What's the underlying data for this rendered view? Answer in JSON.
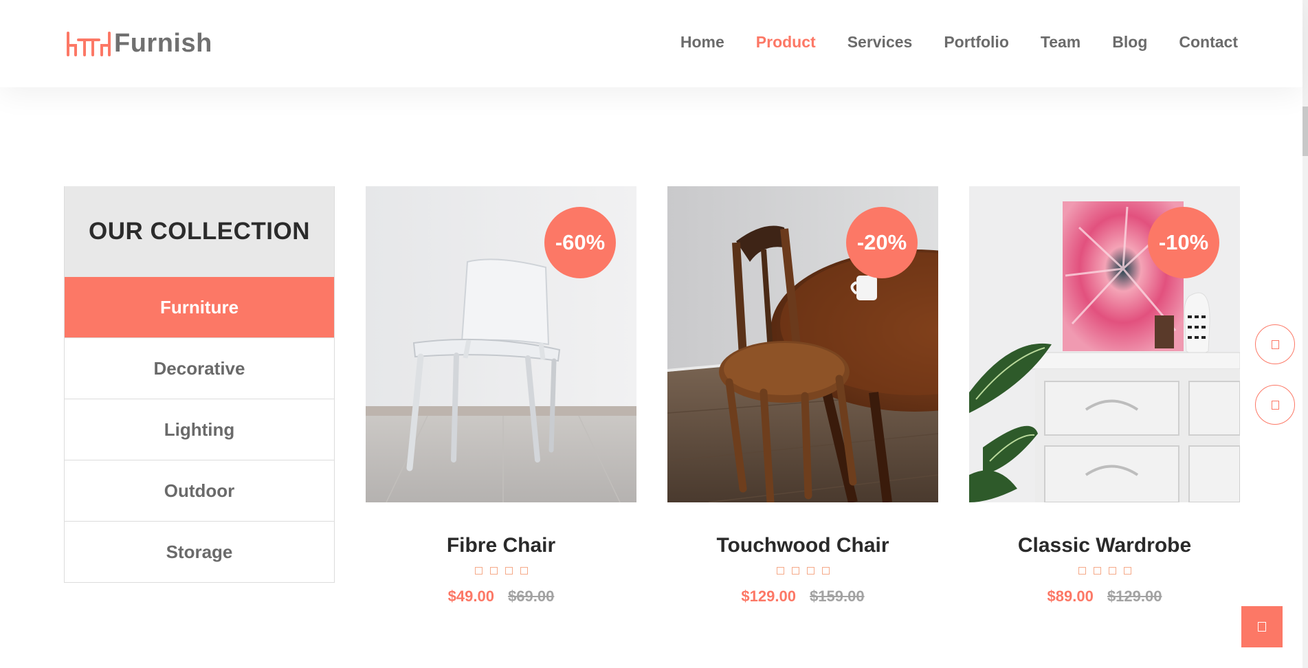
{
  "brand": {
    "name": "Furnish",
    "accent": "#fc7866"
  },
  "nav": {
    "items": [
      {
        "label": "Home"
      },
      {
        "label": "Product"
      },
      {
        "label": "Services"
      },
      {
        "label": "Portfolio"
      },
      {
        "label": "Team"
      },
      {
        "label": "Blog"
      },
      {
        "label": "Contact"
      }
    ],
    "active": "Product"
  },
  "collection": {
    "title": "OUR COLLECTION",
    "categories": [
      {
        "label": "Furniture"
      },
      {
        "label": "Decorative"
      },
      {
        "label": "Lighting"
      },
      {
        "label": "Outdoor"
      },
      {
        "label": "Storage"
      }
    ],
    "active": "Furniture"
  },
  "products": [
    {
      "name": "Fibre Chair",
      "discount": "-60%",
      "price": "$49.00",
      "old_price": "$69.00",
      "image": "white-plastic-chair"
    },
    {
      "name": "Touchwood Chair",
      "discount": "-20%",
      "price": "$129.00",
      "old_price": "$159.00",
      "image": "wooden-chair-table"
    },
    {
      "name": "Classic Wardrobe",
      "discount": "-10%",
      "price": "$89.00",
      "old_price": "$129.00",
      "image": "white-dresser-painting"
    }
  ],
  "icons": {
    "logo": "table-chairs-icon",
    "star": "star-icon",
    "side_1": "cart-icon",
    "side_2": "heart-icon",
    "back_to_top": "arrow-up-icon"
  }
}
